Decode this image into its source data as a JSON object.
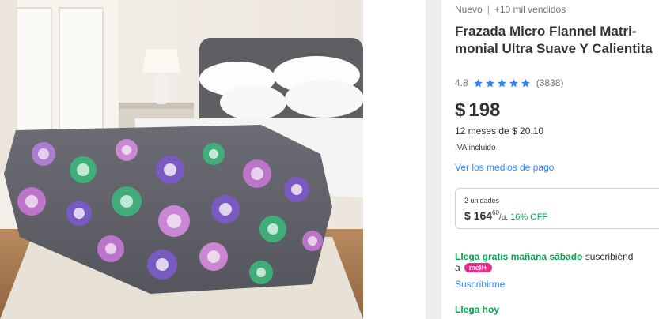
{
  "product": {
    "condition": "Nuevo",
    "sold": "+10 mil vendidos",
    "title": "Frazada Micro Flannel Matri-monial Ultra Suave Y Calientita",
    "rating_value": "4.8",
    "rating_stars": 5,
    "rating_count": "(3838)",
    "currency": "$",
    "price": "198",
    "installments": "12 meses de $ 20.10",
    "tax_note": "IVA incluido",
    "payment_link": "Ver los medios de pago"
  },
  "bulk_offer": {
    "units": "2 unidades",
    "price_main": "$ 164",
    "price_cents": "60",
    "per_unit": "/u.",
    "discount": "16% OFF"
  },
  "shipping": {
    "free_label": "Llega gratis mañana sábado",
    "suffix": "suscribiénd",
    "line2_prefix": "a",
    "badge": "meli+",
    "subscribe_link": "Suscribirme",
    "today_label": "Llega hoy"
  },
  "colors": {
    "accent_blue": "#3483fa",
    "green": "#00a650",
    "star": "#3483fa",
    "badge": "#e62e8e"
  },
  "icons": {
    "star": "star-icon"
  }
}
